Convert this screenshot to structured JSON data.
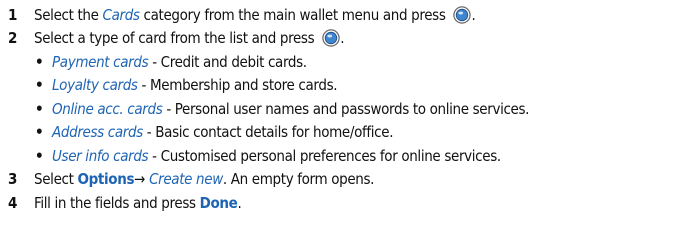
{
  "steps": [
    {
      "num": "1",
      "pre": "Select the ",
      "link": "Cards",
      "post": " category from the main wallet menu and press ",
      "end": "."
    },
    {
      "num": "2",
      "pre": "Select a type of card from the list and press ",
      "end": "."
    },
    {
      "num": "3",
      "pre": "Select ",
      "key": "Options",
      "arrow": "→ ",
      "link": "Create new",
      "post": ". An empty form opens."
    },
    {
      "num": "4",
      "pre": "Fill in the fields and press ",
      "key": "Done",
      "post": "."
    }
  ],
  "card_types": [
    {
      "bullet": "•",
      "name": "Payment cards",
      "desc": " - Credit and debit cards."
    },
    {
      "bullet": "•",
      "name": "Loyalty cards",
      "desc": " - Membership and store cards."
    },
    {
      "bullet": "•",
      "name": "Online acc. cards",
      "desc": " - Personal user names and passwords to online services."
    },
    {
      "bullet": "•",
      "name": "Address cards",
      "desc": " - Basic contact details for home/office."
    },
    {
      "bullet": "•",
      "name": "User info cards",
      "desc": " - Customised personal preferences for online services."
    }
  ],
  "icons": {
    "select_key": "navi-key-select-icon"
  },
  "colors": {
    "link": "#1e64b4",
    "text": "#111111"
  }
}
